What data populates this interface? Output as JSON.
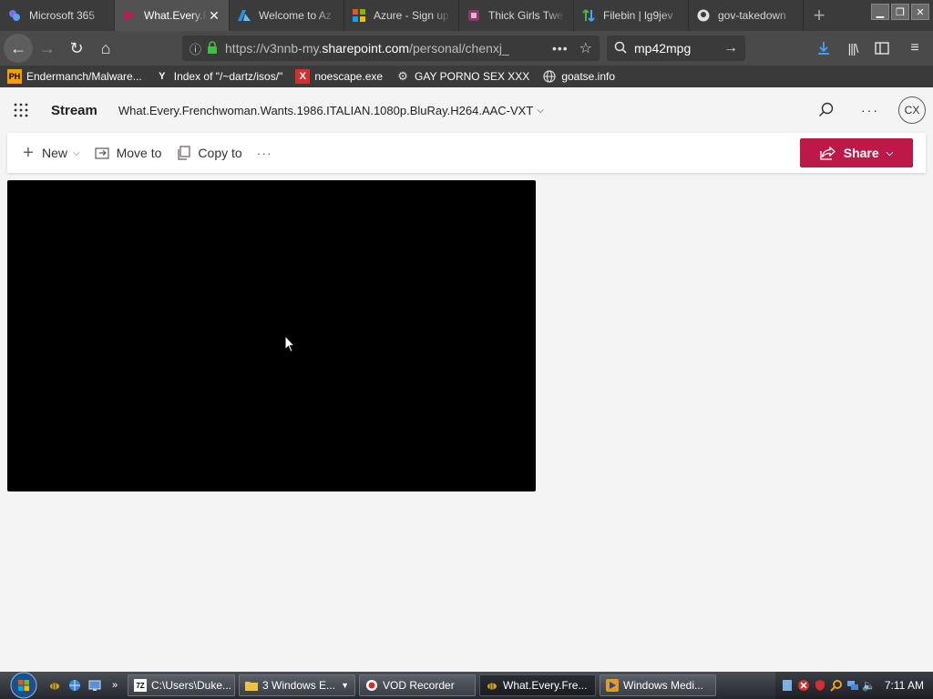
{
  "browser": {
    "tabs": [
      {
        "label": "Microsoft 365",
        "icon": "microsoft365-icon",
        "active": false
      },
      {
        "label": "What.Every.F",
        "icon": "stream-icon",
        "active": true
      },
      {
        "label": "Welcome to Az",
        "icon": "azure-icon",
        "active": false
      },
      {
        "label": "Azure - Sign up",
        "icon": "microsoft-icon",
        "active": false
      },
      {
        "label": "Thick Girls Twe",
        "icon": "site-icon",
        "active": false
      },
      {
        "label": "Filebin | lg9jev",
        "icon": "filebin-icon",
        "active": false
      },
      {
        "label": "gov-takedown",
        "icon": "github-icon",
        "active": false
      }
    ],
    "new_tab_symbol": "+",
    "url": {
      "prefix": "https://v3nnb-my.",
      "host": "sharepoint.com",
      "path": "/personal/chenxj_"
    },
    "search_query": "mp42mpg",
    "bookmarks": [
      {
        "label": "Endermanch/Malware...",
        "icon": "PH"
      },
      {
        "label": "Index of \"/~dartz/isos/\"",
        "icon": "Y"
      },
      {
        "label": "noescape.exe",
        "icon": "X"
      },
      {
        "label": "GAY PORNO SEX XXX",
        "icon": "gear"
      },
      {
        "label": "goatse.info",
        "icon": "globe"
      }
    ]
  },
  "stream": {
    "app_name": "Stream",
    "file_title": "What.Every.Frenchwoman.Wants.1986.ITALIAN.1080p.BluRay.H264.AAC-VXT",
    "avatar_initials": "CX",
    "commands": {
      "new_label": "New",
      "move_label": "Move to",
      "copy_label": "Copy to",
      "more_label": "···"
    },
    "share_label": "Share",
    "colors": {
      "share": "#bc1948",
      "video": "#000000"
    }
  },
  "taskbar": {
    "items": [
      {
        "label": "C:\\Users\\Duke...",
        "icon": "7z",
        "active": false
      },
      {
        "label": "3 Windows E...",
        "icon": "folder",
        "active": false
      },
      {
        "label": "VOD Recorder",
        "icon": "record",
        "active": false
      },
      {
        "label": "What.Every.Fre...",
        "icon": "bee",
        "active": true
      },
      {
        "label": "Windows Medi...",
        "icon": "wmp",
        "active": false
      }
    ],
    "clock": "7:11 AM"
  }
}
